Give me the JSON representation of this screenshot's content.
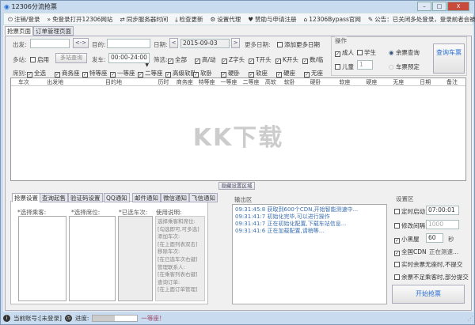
{
  "window": {
    "title": "12306分流抢票",
    "min": "–",
    "max": "□",
    "close": "X"
  },
  "toolbar": [
    {
      "icon": "power-icon",
      "glyph": "⏻",
      "label": "注销/登录"
    },
    {
      "icon": "double-chevron-icon",
      "glyph": "»",
      "label": "免登录打开12306网站"
    },
    {
      "icon": "sync-icon",
      "glyph": "⇄",
      "label": "同步服务器时间"
    },
    {
      "icon": "download-icon",
      "glyph": "⤓",
      "label": "检查更新"
    },
    {
      "icon": "gear-icon",
      "glyph": "⚙",
      "label": "设置代理"
    },
    {
      "icon": "heart-icon",
      "glyph": "♥",
      "label": "赞助与申请注册"
    },
    {
      "icon": "home-icon",
      "glyph": "⌂",
      "label": "12306Bypass官网"
    },
    {
      "icon": "megaphone-icon",
      "glyph": "✎",
      "label": "公告：已关闭多处登录，登录前者会被挤掉！"
    }
  ],
  "tabs": [
    "抢票页面",
    "订单管理页面"
  ],
  "form": {
    "from_label": "出发:",
    "from_value": "",
    "swap": "<->",
    "to_label": "目的:",
    "to_value": "",
    "date_label": "日期:",
    "prev": "<",
    "date": "2015-09-03",
    "next": ">",
    "more_dates_label": "更多日期:",
    "add_more_dates": "添加更多日期",
    "multi_label": "多站:",
    "enable": "启用",
    "multi_query": "多站查询",
    "depart_label": "发车:",
    "depart_time": "00:00-24:00",
    "filter_label": "筛选:",
    "filters": [
      "全部",
      "高/动",
      "Z字头",
      "T开头",
      "K开头",
      "数/临"
    ],
    "seat_label": "席别:",
    "seats": [
      "全选",
      "商务座",
      "特等座",
      "一等座",
      "二等座",
      "高级软卧",
      "软卧",
      "硬卧",
      "软座",
      "硬座",
      "无座"
    ]
  },
  "operation": {
    "title": "操作",
    "adult": "成人",
    "student": "学生",
    "child": "儿童",
    "child_count": "1",
    "remaining_query": "余票查询",
    "ticket_booking": "车票预定",
    "query_button": "查询车票"
  },
  "grid": {
    "columns": [
      "车次",
      "出发地",
      "目的地",
      "历时",
      "商务座",
      "特等座",
      "一等座",
      "二等座",
      "高软",
      "软卧",
      "硬卧",
      "软座",
      "硬座",
      "无座",
      "日期",
      "备注"
    ]
  },
  "watermark": "KK下载",
  "hide_settings": "隐藏设置区域",
  "settings_tabs": [
    "抢票设置",
    "查询起售",
    "验证码设置",
    "QQ通知",
    "邮件通知",
    "微信通知",
    "飞信通知"
  ],
  "settings_columns": {
    "passengers": "*选择乘客:",
    "seats": "*选择席位:",
    "trains": "*已选车次:",
    "usage": "使用说明:"
  },
  "usage_text": [
    "选择乘客和席位:",
    "[勾选即可,可多选]",
    "添加车次:",
    "[在上面列表双击]",
    "移除车次:",
    "[在已选车次右键]",
    "管理联系人:",
    "[在乘客列表右键]",
    "查询订单:",
    "[在上面订单管理]"
  ],
  "output": {
    "title": "输出区",
    "logs": [
      {
        "time": "09:31:45:8",
        "msg": "获取到600个CDN,开始智能测速中..."
      },
      {
        "time": "09:31:41:7",
        "msg": "初始化完毕,可以进行操作"
      },
      {
        "time": "09:31:41:7",
        "msg": "正在初始化配置,下载车站信息..."
      },
      {
        "time": "09:31:41:6",
        "msg": "正在加载配置,请稍等..."
      }
    ]
  },
  "settings": {
    "title": "设置区",
    "timed_start": "定时启动",
    "timed_value": "07:00:01",
    "modify_interval": "修改间隔",
    "interval_value": "1000",
    "blackroom": "小黑屋",
    "blackroom_value": "60",
    "seconds": "秒",
    "cdn": "全国CDN",
    "cdn_status": "正在测速...",
    "no_seat_skip": "实时余票无座时,不提交",
    "partial_submit": "余票不足乘客时,部分提交",
    "start_button": "开始抢票"
  },
  "status": {
    "account": "当前账号:[未登录]",
    "progress_label": "进度:",
    "progress": 0.5,
    "message": "一等座！"
  }
}
